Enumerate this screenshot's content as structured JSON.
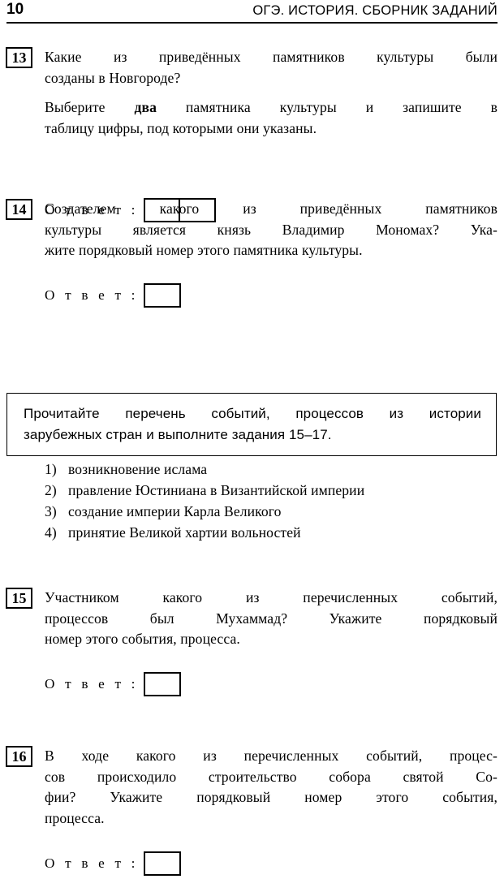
{
  "header": {
    "page_number": "10",
    "title": "ОГЭ. ИСТОРИЯ. СБОРНИК ЗАДАНИЙ"
  },
  "answer_label": "О т в е т :",
  "tasks": [
    {
      "number": "13",
      "paragraph1_line1": "Какие из приведённых памятников культуры были",
      "paragraph1_line2": "созданы в Новгороде?",
      "paragraph2_pre": "Выберите ",
      "paragraph2_bold": "два",
      "paragraph2_post": " памятника культуры и запишите в",
      "paragraph2_line2": "таблицу цифры, под которыми они указаны.",
      "answer_cells": 2
    },
    {
      "number": "14",
      "paragraph1_line1": "Создателем какого из приведённых памятников",
      "paragraph1_line2": "культуры является князь Владимир Мономах? Ука-",
      "paragraph1_line3": "жите порядковый номер этого памятника культуры.",
      "answer_cells": 1
    },
    {
      "number": "15",
      "paragraph1_line1": "Участником какого из перечисленных событий,",
      "paragraph1_line2": "процессов был Мухаммад? Укажите порядковый",
      "paragraph1_line3": "номер этого события, процесса.",
      "answer_cells": 1
    },
    {
      "number": "16",
      "paragraph1_line1": "В ходе какого из перечисленных событий, процес-",
      "paragraph1_line2": "сов происходило строительство собора святой Со-",
      "paragraph1_line3": "фии? Укажите порядковый номер этого события,",
      "paragraph1_line4": "процесса.",
      "answer_cells": 1
    }
  ],
  "instruction": {
    "line1": "Прочитайте перечень событий, процессов из истории",
    "line2": "зарубежных стран и выполните задания 15–17."
  },
  "event_list": [
    {
      "marker": "1)",
      "text": "возникновение ислама"
    },
    {
      "marker": "2)",
      "text": "правление Юстиниана в Византийской империи"
    },
    {
      "marker": "3)",
      "text": "создание империи Карла Великого"
    },
    {
      "marker": "4)",
      "text": "принятие Великой хартии вольностей"
    }
  ]
}
